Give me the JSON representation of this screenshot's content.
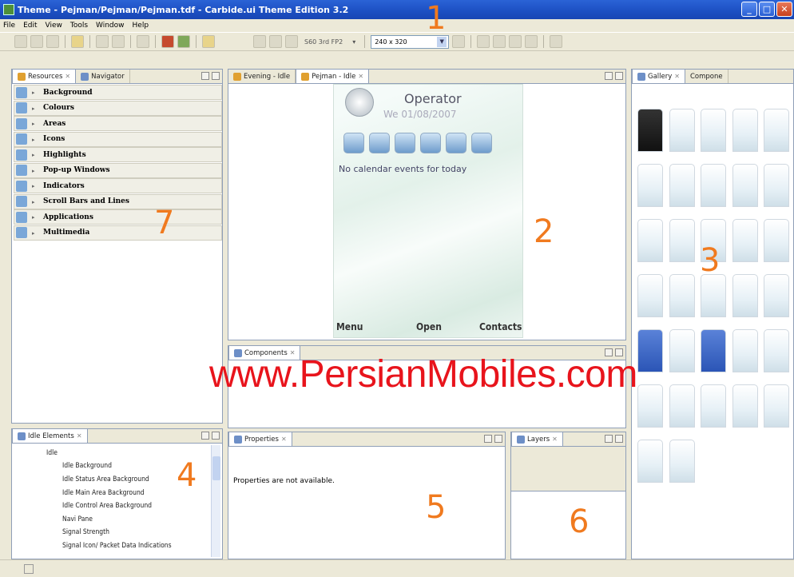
{
  "window": {
    "title": "Theme - Pejman/Pejman/Pejman.tdf - Carbide.ui Theme Edition 3.2"
  },
  "menu": [
    "File",
    "Edit",
    "View",
    "Tools",
    "Window",
    "Help"
  ],
  "toolbar": {
    "device_label": "S60 3rd FP2",
    "resolution": "240 x 320"
  },
  "resources_panel": {
    "tabs": [
      "Resources",
      "Navigator"
    ],
    "items": [
      "Background",
      "Colours",
      "Areas",
      "Icons",
      "Highlights",
      "Pop-up Windows",
      "Indicators",
      "Scroll Bars and Lines",
      "Applications",
      "Multimedia"
    ]
  },
  "editor": {
    "tabs": [
      "Evening - Idle",
      "Pejman - Idle"
    ],
    "phone": {
      "operator": "Operator",
      "date": "We 01/08/2007",
      "calendar": "No calendar events for today",
      "softkeys": [
        "Menu",
        "Open",
        "Contacts"
      ]
    }
  },
  "components_panel": {
    "tab": "Components"
  },
  "gallery_panel": {
    "tabs": [
      "Gallery",
      "Compone"
    ]
  },
  "idle_elements_panel": {
    "tab": "Idle Elements",
    "items": [
      "Idle",
      "Idle Background",
      "Idle Status Area Background",
      "Idle Main Area Background",
      "Idle Control Area Background",
      "Navi Pane",
      "Signal Strength",
      "Signal Icon/ Packet Data Indications"
    ]
  },
  "properties_panel": {
    "tab": "Properties",
    "message": "Properties are not available."
  },
  "layers_panel": {
    "tab": "Layers"
  },
  "watermark": "www.PersianMobiles.com",
  "callouts": [
    "1",
    "2",
    "3",
    "4",
    "5",
    "6",
    "7"
  ],
  "colors": {
    "callout": "#f07a1f",
    "watermark": "#e8141c",
    "titlebar": "#1c4fc2"
  }
}
